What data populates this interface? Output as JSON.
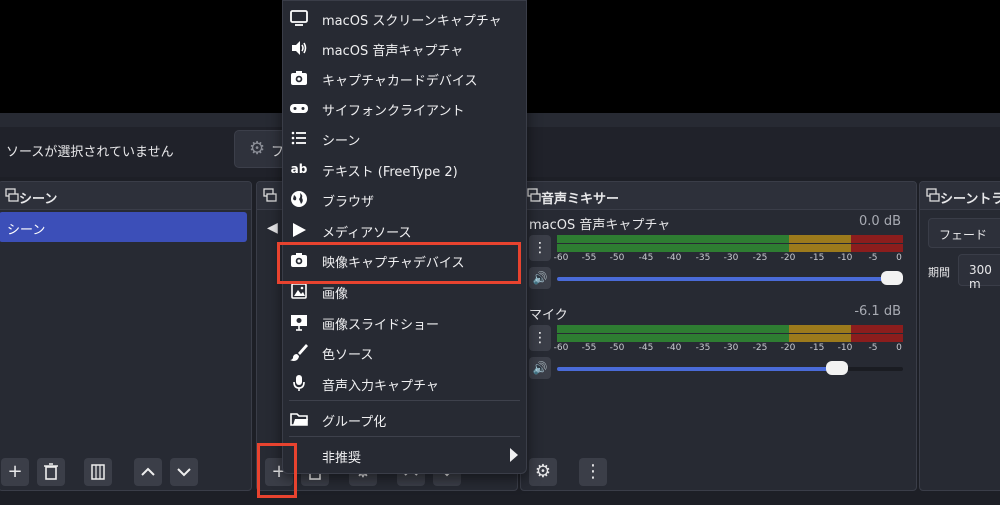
{
  "context": {
    "no_source": "ソースが選択されていません",
    "filters_label": "フ"
  },
  "docks": {
    "scenes": {
      "title": "シーン",
      "items": [
        "シーン"
      ]
    },
    "sources": {
      "title": ""
    },
    "mixer": {
      "title": "音声ミキサー",
      "channels": [
        {
          "name": "macOS 音声キャプチャ",
          "db": "0.0 dB",
          "volume": 1.0
        },
        {
          "name": "マイク",
          "db": "-6.1 dB",
          "volume": 0.83
        }
      ],
      "ticks": [
        "-60",
        "-55",
        "-50",
        "-45",
        "-40",
        "-35",
        "-30",
        "-25",
        "-20",
        "-15",
        "-10",
        "-5",
        "0"
      ]
    },
    "transitions": {
      "title": "シーントラ",
      "type": "フェード",
      "duration_label": "期間",
      "duration": "300 m"
    }
  },
  "menu": {
    "items": [
      {
        "label": "macOS スクリーンキャプチャ",
        "icon": "monitor-icon"
      },
      {
        "label": "macOS 音声キャプチャ",
        "icon": "speaker-icon"
      },
      {
        "label": "キャプチャカードデバイス",
        "icon": "camera-icon"
      },
      {
        "label": "サイフォンクライアント",
        "icon": "gamepad-icon"
      },
      {
        "label": "シーン",
        "icon": "list-icon"
      },
      {
        "label": "テキスト (FreeType 2)",
        "icon": "text-ab-icon"
      },
      {
        "label": "ブラウザ",
        "icon": "globe-icon"
      },
      {
        "label": "メディアソース",
        "icon": "play-icon"
      },
      {
        "label": "映像キャプチャデバイス",
        "icon": "camera-icon"
      },
      {
        "label": "画像",
        "icon": "image-icon"
      },
      {
        "label": "画像スライドショー",
        "icon": "slideshow-icon"
      },
      {
        "label": "色ソース",
        "icon": "brush-icon"
      },
      {
        "label": "音声入力キャプチャ",
        "icon": "microphone-icon"
      }
    ],
    "group": {
      "label": "グループ化",
      "icon": "folder-icon"
    },
    "deprecated": {
      "label": "非推奨",
      "icon": "chevron-right-icon"
    }
  },
  "colors": {
    "highlight": "#e8432f",
    "accent": "#3c4fb8",
    "meter_green": "#2e7d32",
    "meter_yellow": "#9c7a1c",
    "meter_red": "#8b1d1d"
  }
}
